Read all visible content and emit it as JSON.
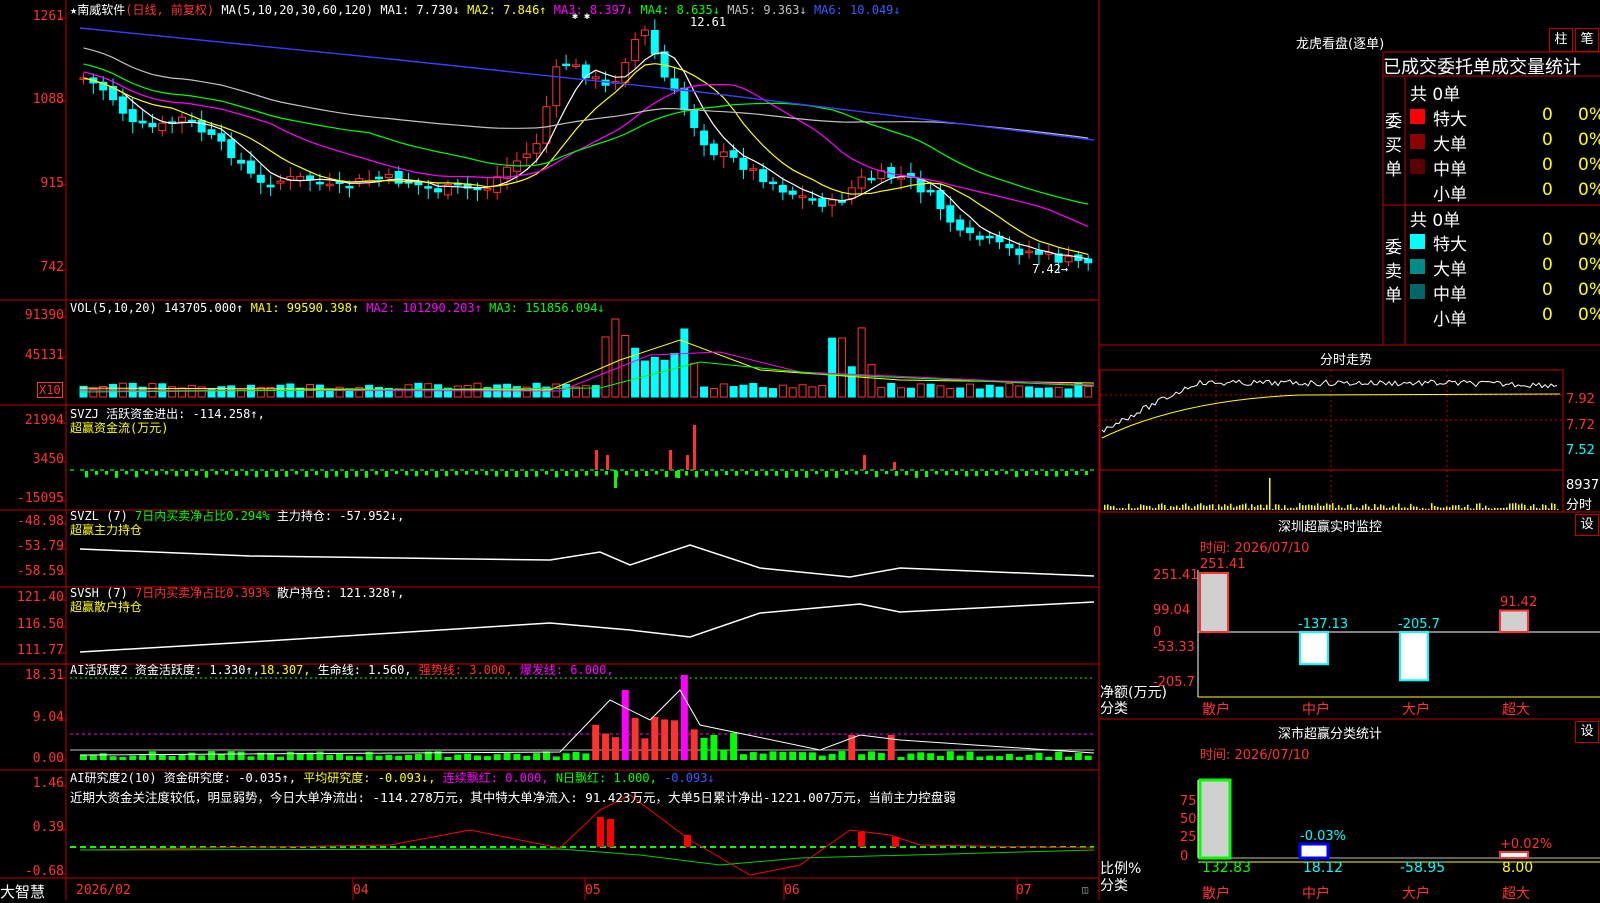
{
  "stock": {
    "star": "★",
    "name": "南威软件",
    "mode": "(日线, 前复权)"
  },
  "kline": {
    "ma_label": "MA(5,10,20,30,60,120)",
    "ma1": "MA1: 7.730↓",
    "ma2": "MA2: 7.846↑",
    "ma3": "MA3: 8.397↓",
    "ma4": "MA4: 8.635↓",
    "ma5": "MA5: 9.363↓",
    "ma6": "MA6: 10.049↓",
    "y_labels": [
      "1261",
      "1088",
      "915",
      "742"
    ],
    "high_mark": "12.61",
    "low_mark": "7.42→",
    "ex_marks": "✱   ✱"
  },
  "vol": {
    "label": "VOL(5,10,20)",
    "value": "143705.000↑",
    "ma1": "MA1: 99590.398↑",
    "ma2": "MA2: 101290.203↑",
    "ma3": "MA3: 151856.094↓",
    "y_labels": [
      "91390",
      "45131"
    ],
    "unit": "X10"
  },
  "svzj": {
    "title": "SVZJ  活跃资金进出: -114.258↑,",
    "sub": "超赢资金流(万元)",
    "y_labels": [
      "21994",
      "3450",
      "-15095"
    ]
  },
  "svzl": {
    "title": "SVZL (7)",
    "ratio": "7日内买卖净占比0.294%",
    "hold": "主力持仓: -57.952↓,",
    "sub": "超赢主力持仓",
    "y_labels": [
      "-48.98",
      "-53.79",
      "-58.59"
    ]
  },
  "svsh": {
    "title": "SVSH (7)",
    "ratio": "7日内买卖净占比0.393%",
    "hold": "散户持仓: 121.328↑,",
    "sub": "超赢散户持仓",
    "y_labels": [
      "121.40",
      "116.50",
      "111.77"
    ]
  },
  "ai1": {
    "title": "AI活跃度2 资金活跃度: 1.330↑,",
    "v2": "18.307,",
    "life": "生命线: 1.560,",
    "strong": "强势线: 3.000,",
    "burst": "爆发线: 6.000,",
    "y_labels": [
      "18.31",
      "9.04",
      "0.00"
    ]
  },
  "ai2": {
    "title": "AI研究度2(10) 资金研究度: -0.035↑,",
    "avg": "平均研究度: -0.093↓,",
    "red": "连续飘红: 0.000,",
    "nred": "N日飘红: 1.000,",
    "last": "-0.093↓",
    "comment": "近期大资金关注度较低，明显弱势，今日大单净流出: -114.278万元，其中特大单净流入: 91.423万元，大单5日累计净出-1221.007万元，当前主力控盘弱",
    "y_labels": [
      "1.46",
      "0.39",
      "-0.68"
    ]
  },
  "xaxis": {
    "labels": [
      "2026/02",
      "04",
      "05",
      "06",
      "07"
    ],
    "brand": "大智慧"
  },
  "panel": {
    "title": "龙虎看盘(逐单)",
    "btn1": "柱",
    "btn2": "笔",
    "heading": "已成交委托单成交量统计",
    "buy": {
      "label": "委买单",
      "total": "共 0单",
      "rows": [
        {
          "name": "特大",
          "val": "0",
          "pct": "0%",
          "color": "#ff0000"
        },
        {
          "name": "大单",
          "val": "0",
          "pct": "0%",
          "color": "#8b0000"
        },
        {
          "name": "中单",
          "val": "0",
          "pct": "0%",
          "color": "#5a0000"
        },
        {
          "name": "小单",
          "val": "0",
          "pct": "0%",
          "color": "#000000"
        }
      ]
    },
    "sell": {
      "label": "委卖单",
      "total": "共 0单",
      "rows": [
        {
          "name": "特大",
          "val": "0",
          "pct": "0%",
          "color": "#00ffff"
        },
        {
          "name": "大单",
          "val": "0",
          "pct": "0%",
          "color": "#008b8b"
        },
        {
          "name": "中单",
          "val": "0",
          "pct": "0%",
          "color": "#006666"
        },
        {
          "name": "小单",
          "val": "0",
          "pct": "0%",
          "color": "#000000"
        }
      ]
    }
  },
  "intraday": {
    "title": "分时走势",
    "y_labels": [
      "7.92",
      "7.72",
      "7.52"
    ],
    "vol_label": "8937",
    "vol_unit": "分时"
  },
  "monitor": {
    "title": "深圳超赢实时监控",
    "btn": "设",
    "time": "时间: 2026/07/10",
    "y_labels": [
      "251.41",
      "99.04",
      "0",
      "-53.33",
      "-205.7"
    ],
    "ylabel": "净额(万元)",
    "xlabel": "分类",
    "categories": [
      "散户",
      "中户",
      "大户",
      "超大"
    ],
    "values": [
      "251.41",
      "-137.13",
      "-205.7",
      "91.42"
    ]
  },
  "classify": {
    "title": "深市超赢分类统计",
    "btn": "设",
    "time": "时间: 2026/07/10",
    "y_labels": [
      "75",
      "50",
      "25",
      "0"
    ],
    "ylabel": "比例%",
    "xlabel": "分类",
    "categories": [
      "散户",
      "中户",
      "大户",
      "超大"
    ],
    "pcts": [
      "",
      "-0.03%",
      "",
      "+0.02%"
    ],
    "values": [
      "132.83",
      "18.12",
      "-58.95",
      "8.00"
    ]
  },
  "chart_data": [
    {
      "type": "bar",
      "title": "深圳超赢实时监控",
      "categories": [
        "散户",
        "中户",
        "大户",
        "超大"
      ],
      "values": [
        251.41,
        -137.13,
        -205.7,
        91.42
      ],
      "ylim": [
        -205.7,
        251.41
      ]
    },
    {
      "type": "line",
      "title": "分时走势",
      "ylim": [
        7.52,
        7.92
      ]
    }
  ]
}
